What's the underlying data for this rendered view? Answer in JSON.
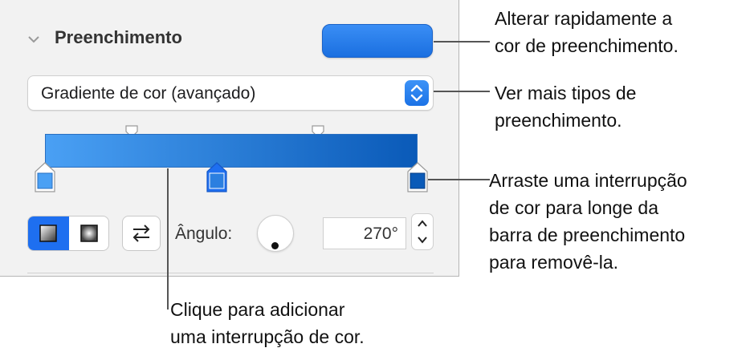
{
  "panel": {
    "section_title": "Preenchimento",
    "fill_type": "Gradiente de cor (avançado)",
    "angle_label": "Ângulo:",
    "angle_value": "270°",
    "colors": {
      "gradient_start": "#4aa0f4",
      "gradient_end": "#0a5ab8",
      "accent": "#1e6ff0",
      "stop_left": "#4aa0f4",
      "stop_middle": "#2b7fe0",
      "stop_right": "#0a5ab8"
    }
  },
  "icons": {
    "disclosure": "chevron-down-icon",
    "popup": "up-down-arrows-icon",
    "linear_gradient": "linear-gradient-icon",
    "radial_gradient": "radial-gradient-icon",
    "swap": "swap-arrows-icon",
    "stepper": "stepper-icon"
  },
  "callouts": {
    "quick_fill": "Alterar rapidamente a\ncor de preenchimento.",
    "fill_types": "Ver mais tipos de\npreenchimento.",
    "drag_stop": "Arraste uma interrupção\nde cor para longe da\nbarra de preenchimento\npara removê-la.",
    "add_stop": "Clique para adicionar\numa interrupção de cor."
  }
}
